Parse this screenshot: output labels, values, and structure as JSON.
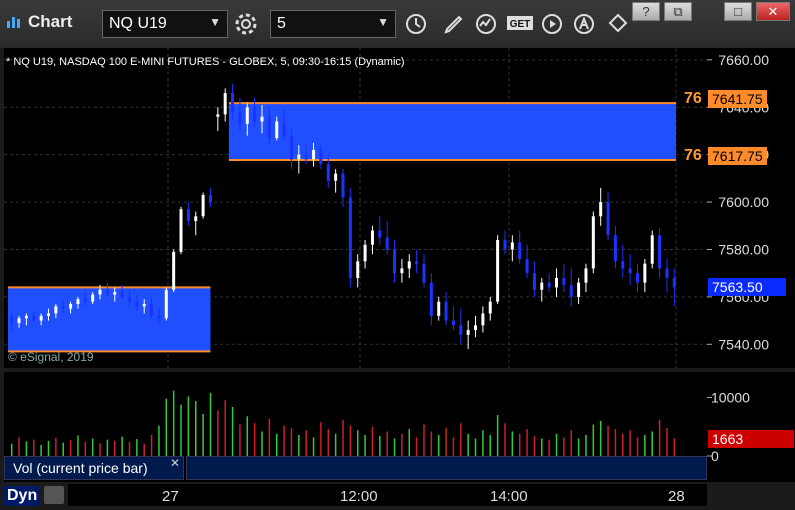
{
  "app": {
    "title": "Chart"
  },
  "toolbar": {
    "symbol": "NQ U19",
    "interval": "5"
  },
  "chart_title": "* NQ U19, NASDAQ 100 E-MINI FUTURES - GLOBEX, 5, 09:30-16:15 (Dynamic)",
  "watermark": "© eSignal, 2019",
  "price_axis": [
    "7660.00",
    "7640.00",
    "7620.00",
    "7600.00",
    "7580.00",
    "7560.00",
    "7540.00"
  ],
  "vol_axis": [
    "10000",
    "0"
  ],
  "time_axis": [
    "27",
    "12:00",
    "14:00",
    "28"
  ],
  "levels": {
    "upper_label": "76",
    "upper_price": "7641.75",
    "lower_label": "76",
    "lower_price": "7617.75",
    "last_price": "7563.50",
    "last_volume": "1663"
  },
  "study_label": "Vol (current price bar)",
  "bottom_mode": "Dyn",
  "colors": {
    "zone": "#1f4fff",
    "level_line": "#ff8a2a",
    "up": "#ffffff",
    "down": "#1a33ff",
    "vol_up": "#33cc33",
    "vol_down": "#cc2222",
    "last_price_bg": "#0a2bff",
    "last_vol_bg": "#cc0000"
  },
  "chart_data": {
    "type": "candlestick",
    "ylim": [
      7530,
      7665
    ],
    "vol_ylim": [
      0,
      13000
    ],
    "zones": [
      {
        "from_bar": 0,
        "to_bar": 27,
        "low": 7537,
        "high": 7564
      },
      {
        "from_bar": 30,
        "to_bar": 115,
        "low": 7617.75,
        "high": 7641.75
      }
    ],
    "candles": [
      [
        7552,
        7553,
        7546,
        7549
      ],
      [
        7549,
        7552,
        7547,
        7551
      ],
      [
        7551,
        7553,
        7548,
        7552
      ],
      [
        7552,
        7554,
        7549,
        7550
      ],
      [
        7550,
        7553,
        7548,
        7552
      ],
      [
        7552,
        7555,
        7550,
        7553
      ],
      [
        7553,
        7557,
        7551,
        7556
      ],
      [
        7556,
        7558,
        7553,
        7555
      ],
      [
        7555,
        7558,
        7553,
        7557
      ],
      [
        7557,
        7560,
        7555,
        7559
      ],
      [
        7559,
        7562,
        7556,
        7558
      ],
      [
        7558,
        7562,
        7557,
        7561
      ],
      [
        7561,
        7565,
        7559,
        7563
      ],
      [
        7563,
        7566,
        7560,
        7561
      ],
      [
        7561,
        7564,
        7558,
        7562
      ],
      [
        7562,
        7565,
        7559,
        7560
      ],
      [
        7560,
        7563,
        7556,
        7558
      ],
      [
        7558,
        7561,
        7554,
        7556
      ],
      [
        7556,
        7559,
        7553,
        7557
      ],
      [
        7557,
        7560,
        7551,
        7552
      ],
      [
        7552,
        7555,
        7549,
        7551
      ],
      [
        7551,
        7564,
        7550,
        7563
      ],
      [
        7563,
        7580,
        7562,
        7579
      ],
      [
        7579,
        7598,
        7578,
        7597
      ],
      [
        7597,
        7600,
        7590,
        7592
      ],
      [
        7592,
        7596,
        7586,
        7594
      ],
      [
        7594,
        7604,
        7593,
        7603
      ],
      [
        7603,
        7606,
        7598,
        7600
      ],
      [
        7636,
        7640,
        7630,
        7637
      ],
      [
        7637,
        7648,
        7634,
        7646
      ],
      [
        7646,
        7650,
        7635,
        7638
      ],
      [
        7638,
        7644,
        7630,
        7633
      ],
      [
        7633,
        7642,
        7628,
        7640
      ],
      [
        7640,
        7644,
        7632,
        7634
      ],
      [
        7634,
        7641,
        7629,
        7636
      ],
      [
        7636,
        7640,
        7624,
        7627
      ],
      [
        7627,
        7636,
        7626,
        7634
      ],
      [
        7634,
        7639,
        7626,
        7628
      ],
      [
        7628,
        7631,
        7614,
        7618
      ],
      [
        7618,
        7624,
        7612,
        7620
      ],
      [
        7620,
        7624,
        7616,
        7618
      ],
      [
        7618,
        7625,
        7615,
        7622
      ],
      [
        7622,
        7624,
        7614,
        7616
      ],
      [
        7616,
        7620,
        7606,
        7609
      ],
      [
        7609,
        7614,
        7604,
        7612
      ],
      [
        7612,
        7614,
        7598,
        7602
      ],
      [
        7602,
        7606,
        7564,
        7568
      ],
      [
        7568,
        7578,
        7564,
        7575
      ],
      [
        7575,
        7584,
        7572,
        7582
      ],
      [
        7582,
        7590,
        7578,
        7588
      ],
      [
        7588,
        7594,
        7582,
        7585
      ],
      [
        7585,
        7592,
        7578,
        7580
      ],
      [
        7580,
        7584,
        7566,
        7570
      ],
      [
        7570,
        7576,
        7566,
        7572
      ],
      [
        7572,
        7578,
        7568,
        7575
      ],
      [
        7575,
        7580,
        7570,
        7574
      ],
      [
        7574,
        7578,
        7564,
        7566
      ],
      [
        7566,
        7570,
        7548,
        7552
      ],
      [
        7552,
        7560,
        7550,
        7558
      ],
      [
        7558,
        7562,
        7548,
        7550
      ],
      [
        7550,
        7556,
        7546,
        7548
      ],
      [
        7548,
        7555,
        7540,
        7544
      ],
      [
        7544,
        7550,
        7538,
        7546
      ],
      [
        7546,
        7552,
        7543,
        7548
      ],
      [
        7548,
        7556,
        7545,
        7553
      ],
      [
        7553,
        7560,
        7550,
        7558
      ],
      [
        7558,
        7586,
        7557,
        7584
      ],
      [
        7584,
        7588,
        7578,
        7580
      ],
      [
        7580,
        7586,
        7575,
        7583
      ],
      [
        7583,
        7588,
        7574,
        7576
      ],
      [
        7576,
        7582,
        7568,
        7570
      ],
      [
        7570,
        7575,
        7560,
        7563
      ],
      [
        7563,
        7568,
        7558,
        7566
      ],
      [
        7566,
        7570,
        7562,
        7564
      ],
      [
        7564,
        7572,
        7560,
        7568
      ],
      [
        7568,
        7574,
        7562,
        7565
      ],
      [
        7565,
        7572,
        7556,
        7560
      ],
      [
        7560,
        7568,
        7557,
        7566
      ],
      [
        7566,
        7574,
        7562,
        7572
      ],
      [
        7572,
        7596,
        7570,
        7594
      ],
      [
        7594,
        7606,
        7590,
        7600
      ],
      [
        7600,
        7604,
        7584,
        7586
      ],
      [
        7586,
        7590,
        7572,
        7575
      ],
      [
        7575,
        7582,
        7568,
        7572
      ],
      [
        7572,
        7578,
        7565,
        7570
      ],
      [
        7570,
        7574,
        7562,
        7566
      ],
      [
        7566,
        7576,
        7562,
        7574
      ],
      [
        7574,
        7588,
        7572,
        7586
      ],
      [
        7586,
        7589,
        7568,
        7572
      ],
      [
        7572,
        7576,
        7562,
        7568
      ],
      [
        7568,
        7572,
        7556,
        7564
      ]
    ],
    "volume": [
      [
        2100,
        1
      ],
      [
        3200,
        0
      ],
      [
        2500,
        1
      ],
      [
        2800,
        0
      ],
      [
        1900,
        1
      ],
      [
        2600,
        1
      ],
      [
        3100,
        0
      ],
      [
        2300,
        1
      ],
      [
        2700,
        0
      ],
      [
        3500,
        1
      ],
      [
        2400,
        0
      ],
      [
        3000,
        1
      ],
      [
        2200,
        0
      ],
      [
        2800,
        1
      ],
      [
        2600,
        0
      ],
      [
        3300,
        1
      ],
      [
        2400,
        0
      ],
      [
        2900,
        1
      ],
      [
        2100,
        0
      ],
      [
        3600,
        0
      ],
      [
        5200,
        1
      ],
      [
        9800,
        1
      ],
      [
        11200,
        1
      ],
      [
        8800,
        1
      ],
      [
        10200,
        1
      ],
      [
        9400,
        1
      ],
      [
        7200,
        1
      ],
      [
        10800,
        1
      ],
      [
        7800,
        0
      ],
      [
        9600,
        0
      ],
      [
        8400,
        1
      ],
      [
        5400,
        0
      ],
      [
        6800,
        1
      ],
      [
        5600,
        0
      ],
      [
        4200,
        1
      ],
      [
        6400,
        0
      ],
      [
        3800,
        1
      ],
      [
        5200,
        0
      ],
      [
        4800,
        0
      ],
      [
        3600,
        1
      ],
      [
        4400,
        0
      ],
      [
        3200,
        1
      ],
      [
        5800,
        0
      ],
      [
        4600,
        0
      ],
      [
        3800,
        1
      ],
      [
        6200,
        0
      ],
      [
        5200,
        0
      ],
      [
        4400,
        1
      ],
      [
        3600,
        1
      ],
      [
        5000,
        0
      ],
      [
        3400,
        1
      ],
      [
        4200,
        0
      ],
      [
        3000,
        1
      ],
      [
        3800,
        0
      ],
      [
        4600,
        1
      ],
      [
        3200,
        0
      ],
      [
        5400,
        0
      ],
      [
        4200,
        0
      ],
      [
        3600,
        1
      ],
      [
        4800,
        0
      ],
      [
        3200,
        0
      ],
      [
        5600,
        0
      ],
      [
        3800,
        1
      ],
      [
        3000,
        1
      ],
      [
        4400,
        1
      ],
      [
        3600,
        1
      ],
      [
        7000,
        1
      ],
      [
        5600,
        0
      ],
      [
        4200,
        1
      ],
      [
        3800,
        0
      ],
      [
        4600,
        0
      ],
      [
        3400,
        0
      ],
      [
        3000,
        1
      ],
      [
        2800,
        0
      ],
      [
        3800,
        1
      ],
      [
        3200,
        0
      ],
      [
        4400,
        0
      ],
      [
        3000,
        1
      ],
      [
        3600,
        1
      ],
      [
        5400,
        1
      ],
      [
        6000,
        1
      ],
      [
        5200,
        0
      ],
      [
        4600,
        0
      ],
      [
        3800,
        0
      ],
      [
        4400,
        0
      ],
      [
        3200,
        0
      ],
      [
        3600,
        1
      ],
      [
        4200,
        1
      ],
      [
        6200,
        0
      ],
      [
        4800,
        0
      ],
      [
        3000,
        0
      ]
    ]
  }
}
